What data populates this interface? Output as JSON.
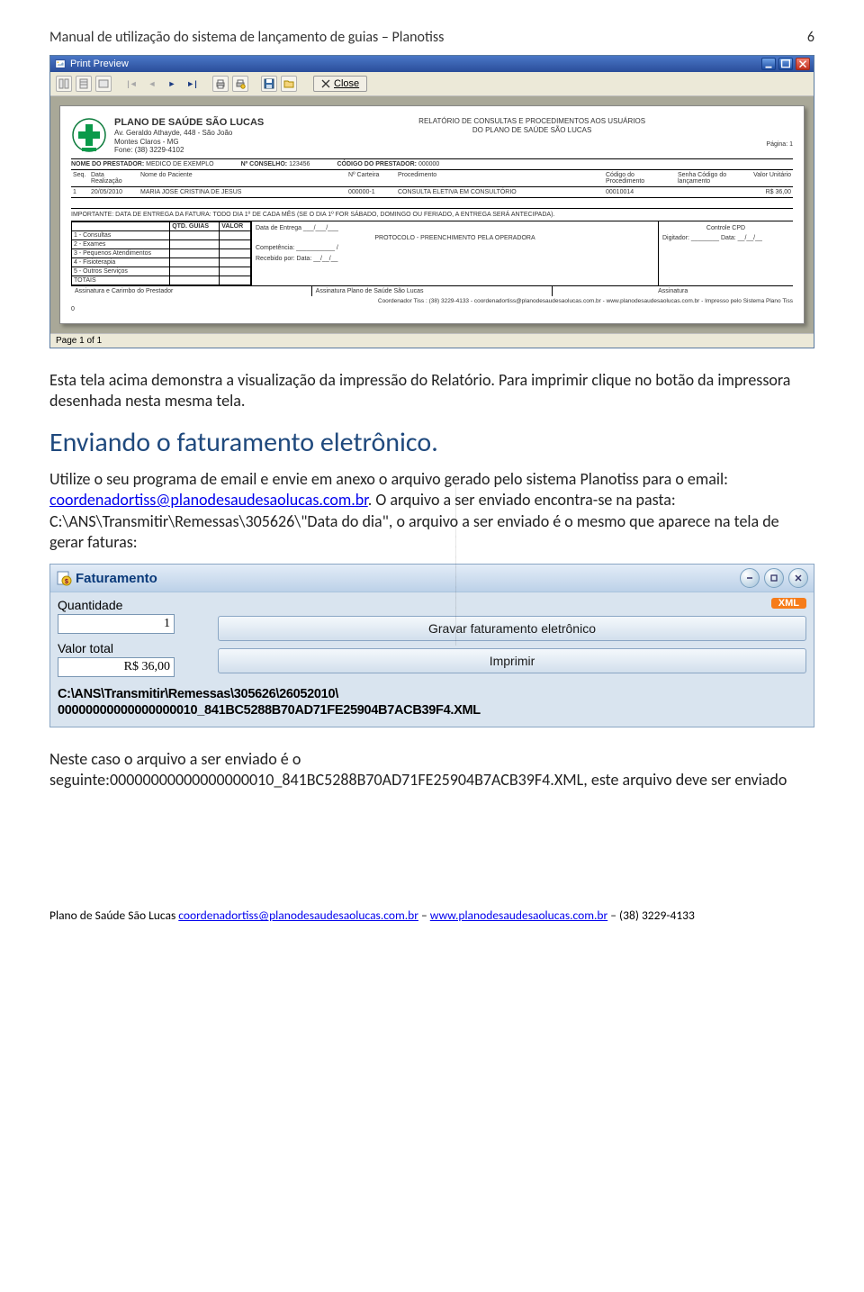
{
  "header": {
    "title": "Manual de utilização do sistema de lançamento de guias – Planotiss",
    "pagenum": "6"
  },
  "printpreview": {
    "title": "Print Preview",
    "close": "Close",
    "status": "Page 1 of 1",
    "org_name": "PLANO DE SAÚDE SÃO LUCAS",
    "org_addr1": "Av. Geraldo Athayde, 448 - São João",
    "org_addr2": "Montes Claros - MG",
    "org_phone": "Fone: (38) 3229-4102",
    "rep_title1": "RELATÓRIO DE CONSULTAS E PROCEDIMENTOS AOS USUÁRIOS",
    "rep_title2": "DO PLANO DE SAÚDE SÃO LUCAS",
    "pagina": "Página: 1",
    "lbl_nome_prest": "NOME DO PRESTADOR:",
    "nome_prest": "MEDICO DE EXEMPLO",
    "lbl_conselho": "Nº CONSELHO:",
    "conselho": "123456",
    "lbl_cod_prest": "CÓDIGO DO PRESTADOR:",
    "cod_prest": "000000",
    "th": {
      "seq": "Seq.",
      "data": "Data Realização",
      "pac": "Nome do Paciente",
      "cart": "Nº Carteira",
      "proc": "Procedimento",
      "cod": "Código do Procedimento",
      "senha": "Senha Código do lançamento",
      "val": "Valor Unitário"
    },
    "row": {
      "seq": "1",
      "data": "20/05/2010",
      "pac": "MARIA JOSE CRISTINA DE JESUS",
      "cart": "000000-1",
      "proc": "CONSULTA ELETIVA EM CONSULTÓRIO",
      "cod": "00010014",
      "senha": "",
      "val": "R$ 36,00"
    },
    "importante": "IMPORTANTE:    DATA DE ENTREGA DA FATURA:    TODO DIA 1º DE CADA MÊS    (SE O DIA 1º FOR SÁBADO, DOMINGO OU FERIADO, A ENTREGA SERÁ ANTECIPADA).",
    "summary": {
      "h_qtd": "QTD. GUIAS",
      "h_valor": "VALOR",
      "rows": [
        "1 - Consultas",
        "2 - Exames",
        "3 - Pequenos Atendimentos",
        "4 - Fisioterapia",
        "5 - Outros Serviços",
        "TOTAIS"
      ]
    },
    "mid": {
      "data_entrega": "Data de Entrega ___/___/___",
      "protocolo": "PROTOCOLO - PREENCHIMENTO PELA OPERADORA",
      "competencia": "Competência: ___________ /",
      "recebido": "Recebido por:                              Data: __/__/__"
    },
    "cpd": {
      "title": "Controle CPD",
      "dig": "Digitador: ________  Data: __/__/__"
    },
    "assign1": "Assinatura e Carimbo do Prestador",
    "assign2": "Assinatura Plano de Saúde São Lucas",
    "assign3": "Assinatura",
    "coord_foot": "Coordenador Tiss : (38) 3229-4133 - coordenadortiss@planodesaudesaolucas.com.br - www.planodesaudesaolucas.com.br - Impresso pelo Sistema Plano Tiss"
  },
  "body": {
    "p1": "Esta tela acima demonstra a visualização da impressão do Relatório. Para imprimir clique no botão da impressora desenhada nesta mesma tela.",
    "h2": "Enviando o faturamento eletrônico.",
    "p2a": "Utilize o seu programa de email e envie em anexo o arquivo gerado pelo sistema Planotiss para o email: ",
    "email": "coordenadortiss@planodesaudesaolucas.com.br",
    "p2b": ". O arquivo a ser enviado encontra-se na pasta: C:\\ANS\\Transmitir\\Remessas\\305626\\\"Data do dia\", o arquivo a ser enviado é o mesmo que aparece na tela de gerar faturas:",
    "p3": "Neste caso o arquivo a ser enviado é o seguinte:00000000000000000010_841BC5288B70AD71FE25904B7ACB39F4.XML, este arquivo deve ser enviado"
  },
  "fat": {
    "title": "Faturamento",
    "lbl_qt": "Quantidade",
    "val_qt": "1",
    "lbl_tot": "Valor total",
    "val_tot": "R$ 36,00",
    "xml": "XML",
    "btn1": "Gravar faturamento eletrônico",
    "btn2": "Imprimir",
    "path": "C:\\ANS\\Transmitir\\Remessas\\305626\\26052010\\\n00000000000000000010_841BC5288B70AD71FE25904B7ACB39F4.XML"
  },
  "footer": {
    "txt1": "Plano de Saúde São Lucas ",
    "email": "coordenadortiss@planodesaudesaolucas.com.br",
    "sep": " – ",
    "site": "www.planodesaudesaolucas.com.br",
    "phone": " – (38) 3229-4133"
  }
}
